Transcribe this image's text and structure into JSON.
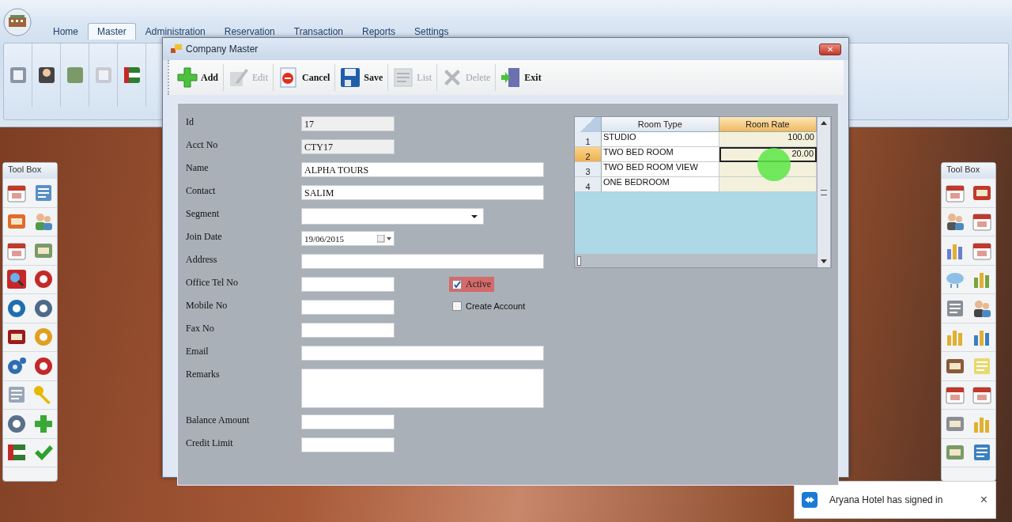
{
  "ribbon": {
    "tabs": [
      {
        "label": "Home",
        "selected": false
      },
      {
        "label": "Master",
        "selected": true
      },
      {
        "label": "Administration",
        "selected": false
      },
      {
        "label": "Reservation",
        "selected": false
      },
      {
        "label": "Transaction",
        "selected": false
      },
      {
        "label": "Reports",
        "selected": false
      },
      {
        "label": "Settings",
        "selected": false
      }
    ]
  },
  "window": {
    "title": "Company Master",
    "close": "✕"
  },
  "toolbar": [
    {
      "label": "Add",
      "kind": "add",
      "disabled": false
    },
    {
      "label": "Edit",
      "kind": "edit",
      "disabled": true
    },
    {
      "label": "Cancel",
      "kind": "cancel",
      "disabled": false
    },
    {
      "label": "Save",
      "kind": "save",
      "disabled": false
    },
    {
      "label": "List",
      "kind": "list",
      "disabled": true
    },
    {
      "label": "Delete",
      "kind": "delete",
      "disabled": true
    },
    {
      "label": "Exit",
      "kind": "exit",
      "disabled": false
    }
  ],
  "form": {
    "fields": [
      {
        "label": "Id",
        "value": "17",
        "kind": "readonly"
      },
      {
        "label": "Acct No",
        "value": "CTY17",
        "kind": "readonly"
      },
      {
        "label": "Name",
        "value": "ALPHA TOURS",
        "kind": "wide"
      },
      {
        "label": "Contact",
        "value": "SALIM",
        "kind": "wide"
      },
      {
        "label": "Segment",
        "kind": "dropdown"
      },
      {
        "label": "Join Date",
        "value": "19/06/2015",
        "kind": "date"
      },
      {
        "label": "Address",
        "kind": "wide"
      },
      {
        "label": "Office Tel No",
        "kind": "short"
      },
      {
        "label": "Mobile No",
        "kind": "short"
      },
      {
        "label": "Fax No",
        "kind": "short"
      },
      {
        "label": "Email",
        "kind": "wide"
      },
      {
        "label": "Remarks",
        "kind": "memo"
      },
      {
        "label": "Balance Amount",
        "kind": "short"
      },
      {
        "label": "Credit Limit",
        "kind": "short"
      }
    ],
    "checkboxes": [
      {
        "label": "Active",
        "checked": true,
        "focused": true
      },
      {
        "label": "Create Account",
        "checked": false,
        "focused": false
      }
    ]
  },
  "grid": {
    "columns": [
      "Room Type",
      "Room Rate"
    ],
    "rows": [
      {
        "number": "1",
        "room_type": "STUDIO",
        "room_rate": "100.00",
        "selected": false
      },
      {
        "number": "2",
        "room_type": "TWO BED ROOM",
        "room_rate": "20.00",
        "selected": true
      },
      {
        "number": "3",
        "room_type": "TWO BED ROOM VIEW",
        "selected": false
      },
      {
        "number": "4",
        "room_type": "ONE BEDROOM",
        "selected": false
      }
    ]
  },
  "tool_boxes": [
    {
      "title": "Tool Box"
    },
    {
      "title": "Tool Box"
    }
  ],
  "notification": {
    "message": "Aryana Hotel has signed in",
    "close": "×"
  }
}
